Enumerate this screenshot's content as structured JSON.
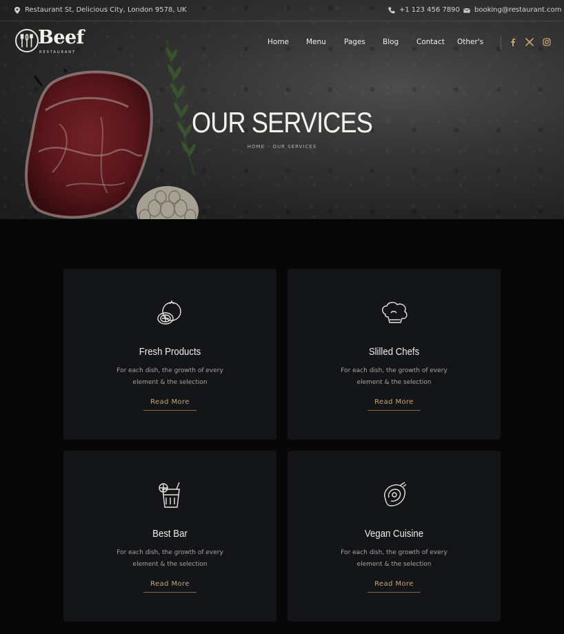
{
  "topbar": {
    "address": "Restaurant St, Delicious City, London 9578, UK",
    "phone": "+1 123 456 7890",
    "email": "booking@restaurant.com"
  },
  "logo": {
    "word": "Beef",
    "subtitle": "RESTAURANT"
  },
  "nav": [
    "Home",
    "Menu",
    "Pages",
    "Blog",
    "Contact",
    "Other's"
  ],
  "social": [
    "facebook-icon",
    "x-icon",
    "instagram-icon"
  ],
  "hero": {
    "title": "OUR SERVICES",
    "breadcrumb": {
      "home": "HOME",
      "separator": "-",
      "current": "OUR SERVICES"
    }
  },
  "services": [
    {
      "title": "Fresh Products",
      "desc_line1": "For each dish, the growth of every",
      "desc_line2": "element & the selection",
      "link": "Read More",
      "icon": "tomato-icon"
    },
    {
      "title": "Slilled Chefs",
      "desc_line1": "For each dish, the growth of every",
      "desc_line2": "element & the selection",
      "link": "Read More",
      "icon": "chef-hat-icon"
    },
    {
      "title": "Best Bar",
      "desc_line1": "For each dish, the growth of every",
      "desc_line2": "element & the selection",
      "link": "Read More",
      "icon": "cocktail-glass-icon"
    },
    {
      "title": "Vegan Cuisine",
      "desc_line1": "For each dish, the growth of every",
      "desc_line2": "element & the selection",
      "link": "Read More",
      "icon": "steak-icon"
    }
  ],
  "colors": {
    "accent": "#c9a46c",
    "card": "#141518",
    "background": "#070708"
  }
}
